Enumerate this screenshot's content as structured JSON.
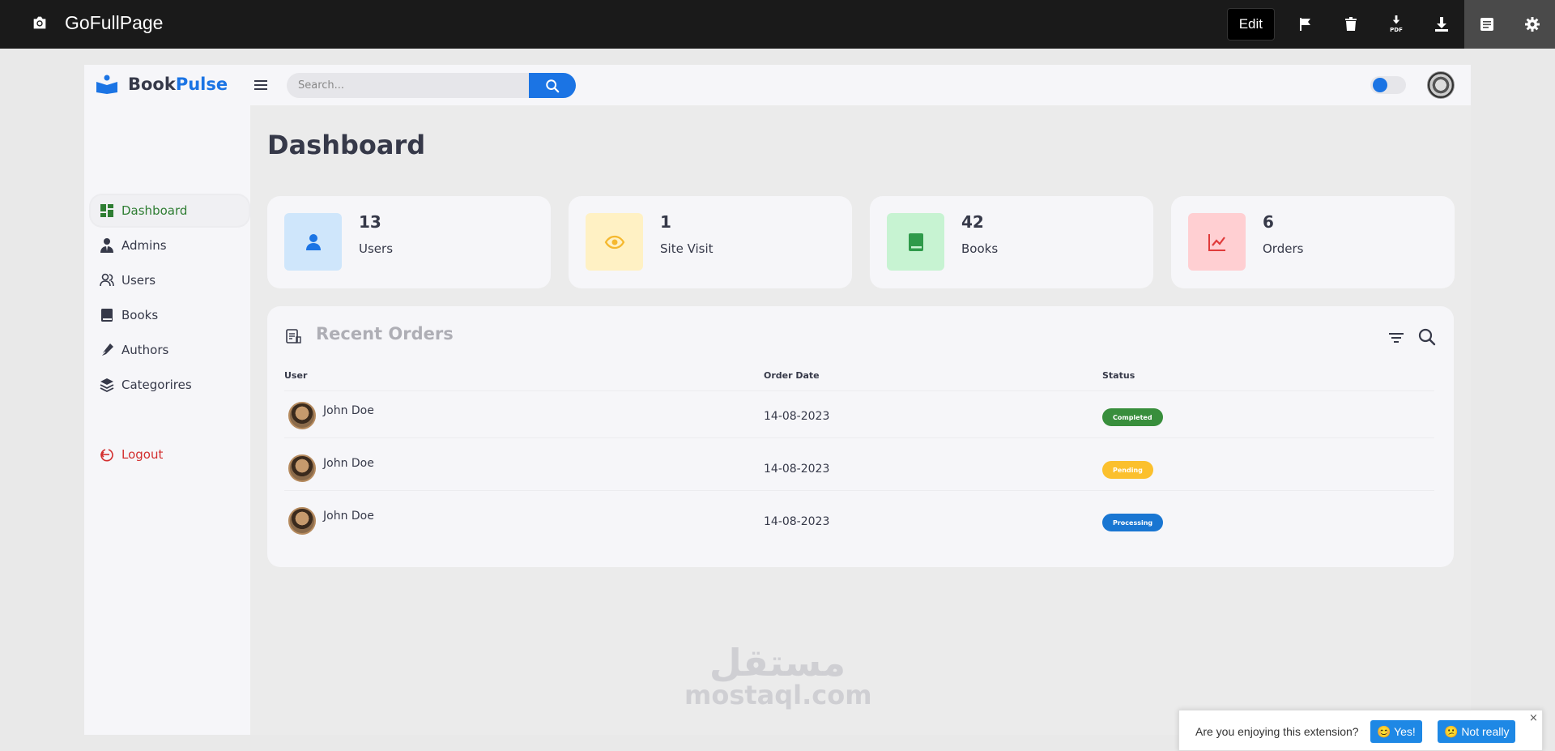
{
  "extension": {
    "title": "GoFullPage",
    "edit_label": "Edit",
    "pdf_label": "PDF",
    "icons": [
      "camera-icon",
      "flag-icon",
      "trash-icon",
      "download-pdf-icon",
      "download-icon",
      "file-icon",
      "gear-icon"
    ]
  },
  "app": {
    "brand_first": "Book",
    "brand_second": "Pulse",
    "brand_color": "#1b74e4",
    "search": {
      "placeholder": "Search..."
    }
  },
  "sidebar": {
    "items": [
      {
        "label": "Dashboard",
        "icon": "dashboard-icon",
        "active": true
      },
      {
        "label": "Admins",
        "icon": "admin-icon"
      },
      {
        "label": "Users",
        "icon": "users-icon"
      },
      {
        "label": "Books",
        "icon": "book-icon"
      },
      {
        "label": "Authors",
        "icon": "pen-icon"
      },
      {
        "label": "Categorires",
        "icon": "layers-icon"
      }
    ],
    "logout": {
      "label": "Logout",
      "icon": "logout-icon",
      "color": "#d32f2f"
    }
  },
  "main": {
    "title": "Dashboard",
    "cards": [
      {
        "value": "13",
        "label": "Users",
        "icon": "user-icon",
        "bg": "#cfe6fb",
        "color": "#1b74e4"
      },
      {
        "value": "1",
        "label": "Site Visit",
        "icon": "eye-icon",
        "bg": "#fff1c4",
        "color": "#f5b82e"
      },
      {
        "value": "42",
        "label": "Books",
        "icon": "book-icon",
        "bg": "#c7f3d2",
        "color": "#2e9a4a"
      },
      {
        "value": "6",
        "label": "Orders",
        "icon": "chart-line-icon",
        "bg": "#ffcfd2",
        "color": "#e03b3b"
      }
    ],
    "orders": {
      "title": "Recent Orders",
      "columns": [
        "User",
        "Order Date",
        "Status"
      ],
      "rows": [
        {
          "user": "John Doe",
          "date": "14-08-2023",
          "status": "Completed",
          "status_color": "#388e3c"
        },
        {
          "user": "John Doe",
          "date": "14-08-2023",
          "status": "Pending",
          "status_color": "#fbc02d"
        },
        {
          "user": "John Doe",
          "date": "14-08-2023",
          "status": "Processing",
          "status_color": "#1976d2"
        }
      ]
    }
  },
  "watermark": {
    "arabic": "مستقل",
    "latin": "mostaql.com"
  },
  "toast": {
    "question": "Are you enjoying this extension?",
    "yes_label": "😊 Yes!",
    "no_label": "😕 Not really",
    "close": "×"
  }
}
